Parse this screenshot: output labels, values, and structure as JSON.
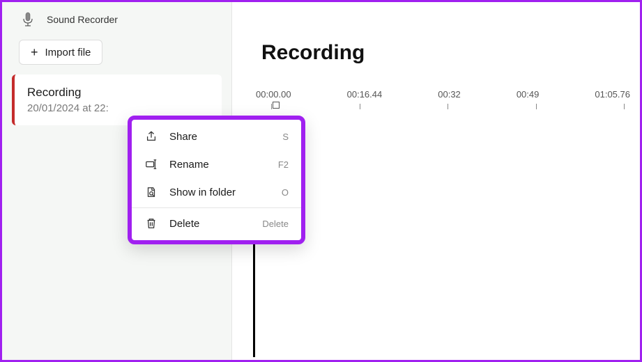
{
  "app": {
    "title": "Sound Recorder",
    "import_label": "Import file"
  },
  "recording": {
    "title": "Recording",
    "subtitle": "20/01/2024 at 22:"
  },
  "main": {
    "title": "Recording",
    "timeline": [
      "00:00.00",
      "00:16.44",
      "00:32",
      "00:49",
      "01:05.76"
    ]
  },
  "context_menu": {
    "items": [
      {
        "icon": "share-icon",
        "label": "Share",
        "shortcut": "S"
      },
      {
        "icon": "rename-icon",
        "label": "Rename",
        "shortcut": "F2"
      },
      {
        "icon": "folder-icon",
        "label": "Show in folder",
        "shortcut": "O"
      },
      {
        "icon": "delete-icon",
        "label": "Delete",
        "shortcut": "Delete"
      }
    ]
  }
}
